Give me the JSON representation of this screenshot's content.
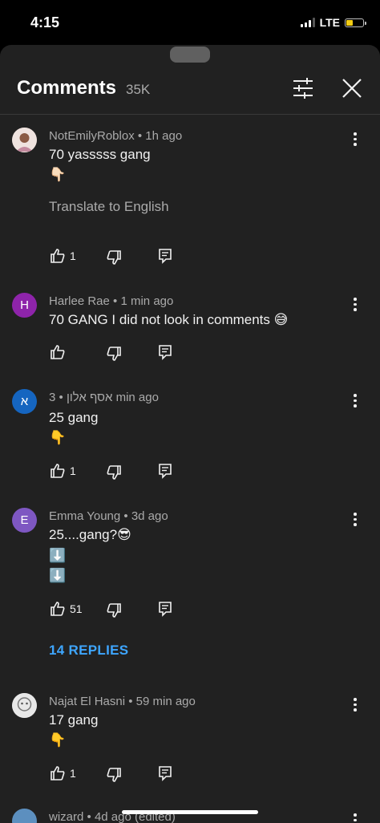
{
  "status": {
    "time": "4:15",
    "network": "LTE"
  },
  "header": {
    "title": "Comments",
    "count": "35K"
  },
  "comments": [
    {
      "author": "NotEmilyRoblox",
      "age": "1h ago",
      "lines": [
        "70 yasssss gang",
        "👇🏻"
      ],
      "translate": "Translate to English",
      "likes": "1",
      "avatar_color": "#d9c6c2"
    },
    {
      "author": "Harlee Rae",
      "age": "1 min ago",
      "lines": [
        "70 GANG I did not look in comments 😅"
      ],
      "likes": "",
      "avatar_letter": "H",
      "avatar_color": "#8e24aa"
    },
    {
      "author": "אסף אלון",
      "age": "3 min ago",
      "lines": [
        "25 gang",
        "👇"
      ],
      "likes": "1",
      "avatar_letter": "א",
      "avatar_color": "#1565c0"
    },
    {
      "author": "Emma Young",
      "age": "3d ago",
      "lines": [
        "25....gang?😎",
        "⬇️",
        "⬇️"
      ],
      "likes": "51",
      "avatar_letter": "E",
      "avatar_color": "#7e57c2",
      "replies": "14 REPLIES"
    },
    {
      "author": "Najat El Hasni",
      "age": "59 min ago",
      "lines": [
        "17 gang",
        "👇"
      ],
      "likes": "1",
      "avatar_color": "#e0e0e0"
    },
    {
      "author": "wizard",
      "age": "4d ago (edited)",
      "lines": [],
      "avatar_color": "#5c8fbf"
    }
  ],
  "colors": {
    "sheet": "#212121",
    "accent": "#3ea6ff",
    "secondary_text": "#aaaaaa"
  }
}
